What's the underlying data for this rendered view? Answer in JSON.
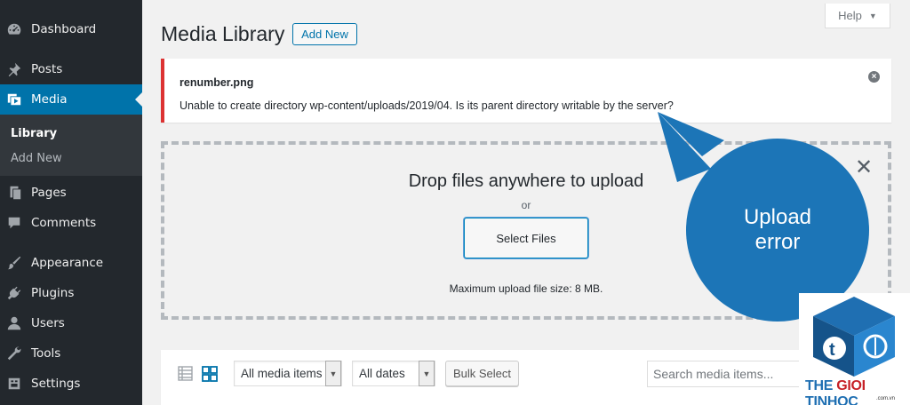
{
  "sidebar": {
    "items": [
      {
        "label": "Dashboard",
        "icon": "dashboard-icon"
      },
      {
        "label": "Posts",
        "icon": "pin-icon"
      },
      {
        "label": "Media",
        "icon": "media-icon",
        "active": true
      },
      {
        "label": "Pages",
        "icon": "pages-icon"
      },
      {
        "label": "Comments",
        "icon": "comment-icon"
      },
      {
        "label": "Appearance",
        "icon": "brush-icon"
      },
      {
        "label": "Plugins",
        "icon": "plug-icon"
      },
      {
        "label": "Users",
        "icon": "user-icon"
      },
      {
        "label": "Tools",
        "icon": "wrench-icon"
      },
      {
        "label": "Settings",
        "icon": "settings-icon"
      }
    ],
    "submenu": [
      {
        "label": "Library",
        "current": true
      },
      {
        "label": "Add New"
      }
    ]
  },
  "header": {
    "title": "Media Library",
    "add_new": "Add New",
    "help": "Help"
  },
  "notice": {
    "filename": "renumber.png",
    "message": "Unable to create directory wp-content/uploads/2019/04. Is its parent directory writable by the server?",
    "dismiss": "×"
  },
  "upload": {
    "close": "✕",
    "drop": "Drop files anywhere to upload",
    "or": "or",
    "select": "Select Files",
    "max_size": "Maximum upload file size: 8 MB."
  },
  "toolbar": {
    "filter_type": "All media items",
    "filter_date": "All dates",
    "bulk_select": "Bulk Select",
    "search_placeholder": "Search media items..."
  },
  "callout": {
    "line1": "Upload",
    "line2": "error"
  },
  "logo": {
    "the": "THE ",
    "gioi": "GIOI ",
    "tinhoc": "TINHOC",
    "domain": ".com.vn"
  },
  "colors": {
    "accent": "#0073aa",
    "error": "#dc3232",
    "sidebar_bg": "#23282d",
    "callout": "#1c75b7"
  }
}
